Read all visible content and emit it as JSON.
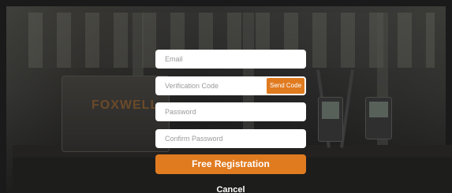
{
  "background": {
    "brand_text": "FOXWELL"
  },
  "form": {
    "email_placeholder": "Email",
    "verification_placeholder": "Verification Code",
    "send_code_label": "Send Code",
    "password_placeholder": "Password",
    "confirm_password_placeholder": "Confirm Password",
    "register_label": "Free Registration",
    "cancel_label": "Cancel"
  },
  "colors": {
    "accent": "#e07b20",
    "field_background": "#ffffff",
    "overlay": "#1a1a1a"
  }
}
